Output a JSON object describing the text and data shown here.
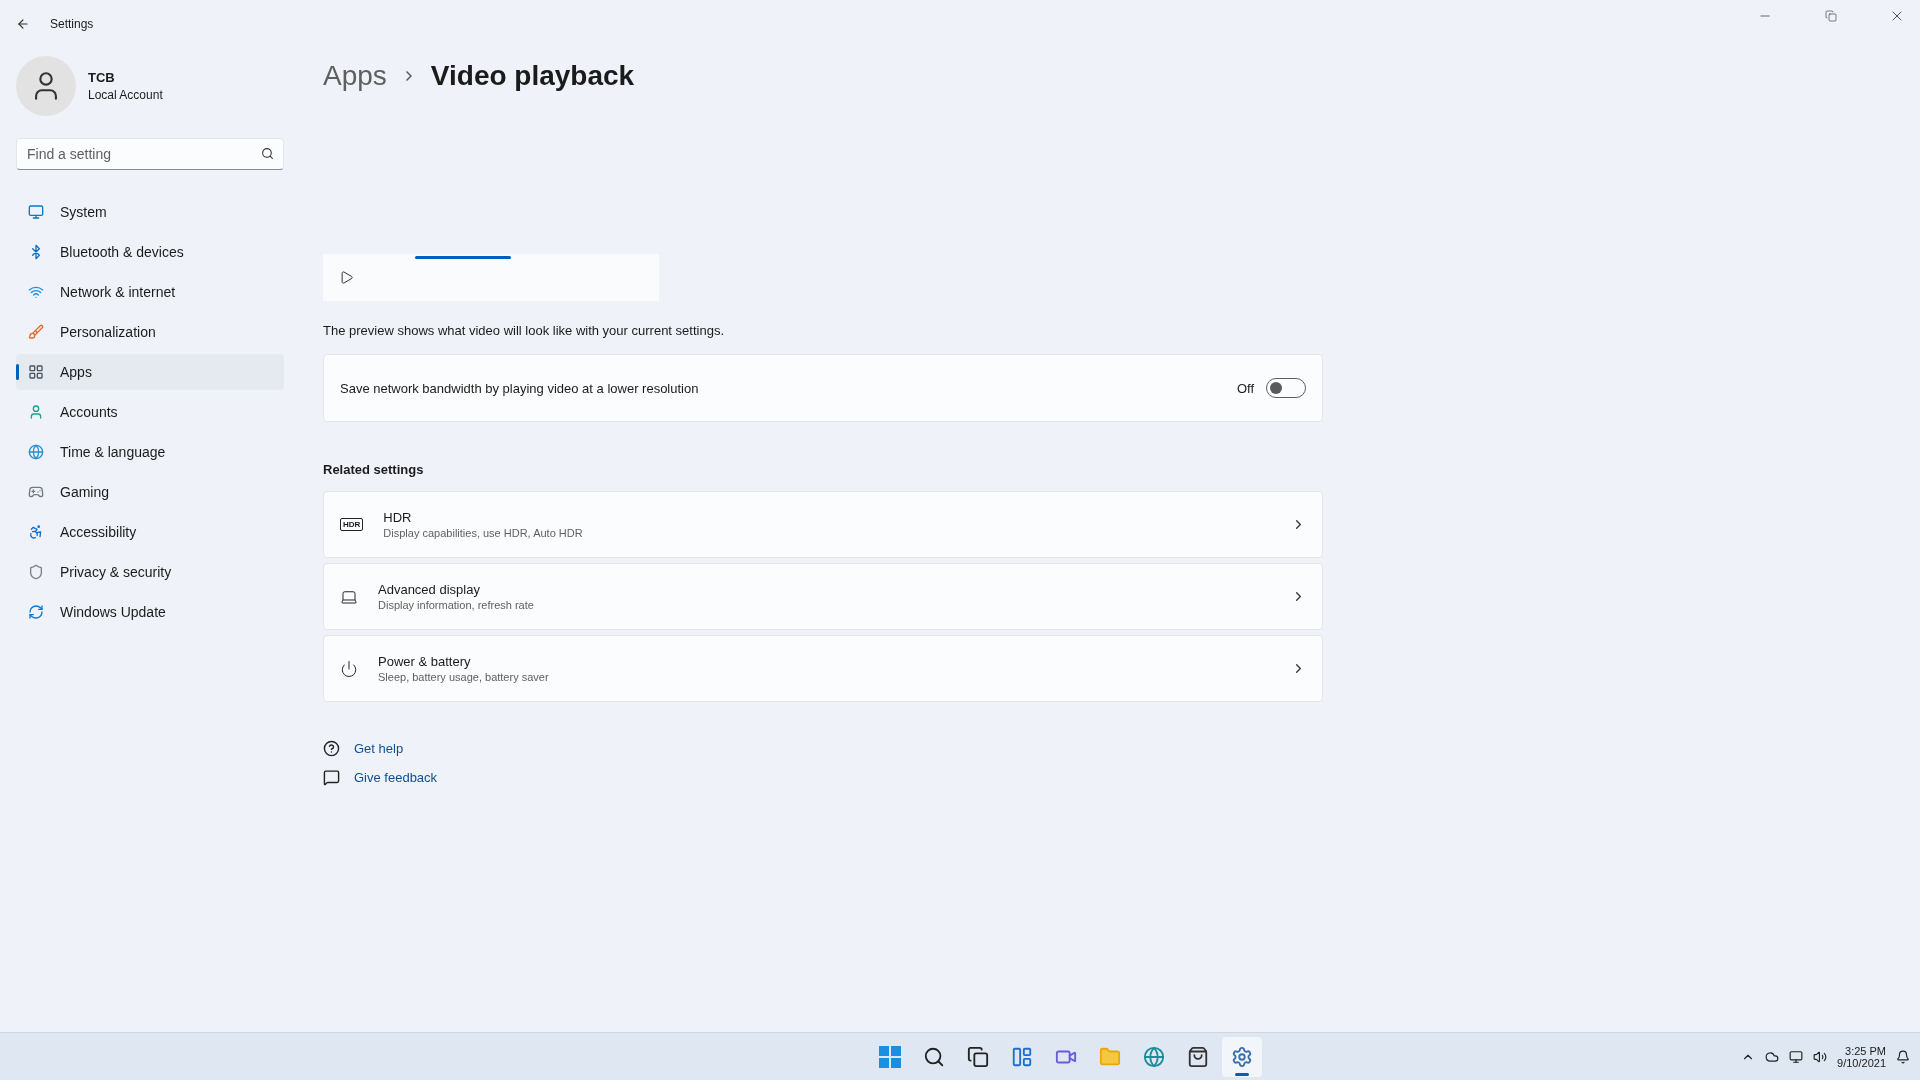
{
  "window": {
    "title": "Settings"
  },
  "user": {
    "name": "TCB",
    "account": "Local Account"
  },
  "search": {
    "placeholder": "Find a setting"
  },
  "nav": [
    {
      "kind": "system",
      "label": "System",
      "selected": false
    },
    {
      "kind": "bluetooth",
      "label": "Bluetooth & devices",
      "selected": false
    },
    {
      "kind": "network",
      "label": "Network & internet",
      "selected": false
    },
    {
      "kind": "personalization",
      "label": "Personalization",
      "selected": false
    },
    {
      "kind": "apps",
      "label": "Apps",
      "selected": true
    },
    {
      "kind": "accounts",
      "label": "Accounts",
      "selected": false
    },
    {
      "kind": "time",
      "label": "Time & language",
      "selected": false
    },
    {
      "kind": "gaming",
      "label": "Gaming",
      "selected": false
    },
    {
      "kind": "accessibility",
      "label": "Accessibility",
      "selected": false
    },
    {
      "kind": "privacy",
      "label": "Privacy & security",
      "selected": false
    },
    {
      "kind": "update",
      "label": "Windows Update",
      "selected": false
    }
  ],
  "breadcrumb": {
    "parent": "Apps",
    "current": "Video playback"
  },
  "preview": {
    "caption": "The preview shows what video will look like with your current settings."
  },
  "setting": {
    "label": "Save network bandwidth by playing video at a lower resolution",
    "state": "Off",
    "on": false
  },
  "related": {
    "heading": "Related settings",
    "items": [
      {
        "kind": "hdr",
        "badge": "HDR",
        "title": "HDR",
        "subtitle": "Display capabilities, use HDR, Auto HDR"
      },
      {
        "kind": "display",
        "title": "Advanced display",
        "subtitle": "Display information, refresh rate"
      },
      {
        "kind": "power",
        "title": "Power & battery",
        "subtitle": "Sleep, battery usage, battery saver"
      }
    ]
  },
  "links": [
    {
      "kind": "help",
      "label": "Get help"
    },
    {
      "kind": "feedback",
      "label": "Give feedback"
    }
  ],
  "taskbar": {
    "apps": [
      {
        "kind": "start",
        "selected": false
      },
      {
        "kind": "search",
        "selected": false
      },
      {
        "kind": "taskview",
        "selected": false
      },
      {
        "kind": "widgets",
        "selected": false
      },
      {
        "kind": "chat",
        "selected": false
      },
      {
        "kind": "explorer",
        "selected": false
      },
      {
        "kind": "edge",
        "selected": false
      },
      {
        "kind": "store",
        "selected": false
      },
      {
        "kind": "settings",
        "selected": true
      }
    ]
  },
  "tray": {
    "time": "3:25 PM",
    "date": "9/10/2021"
  }
}
